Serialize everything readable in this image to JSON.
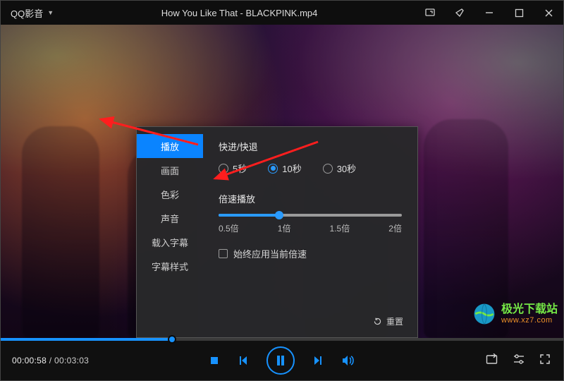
{
  "titlebar": {
    "brand": "QQ影音",
    "title": "How You Like That - BLACKPINK.mp4"
  },
  "settings": {
    "tabs": [
      "播放",
      "画面",
      "色彩",
      "声音",
      "载入字幕",
      "字幕样式"
    ],
    "active_tab": "播放",
    "seek_section_title": "快进/快退",
    "seek_options": [
      "5秒",
      "10秒",
      "30秒"
    ],
    "seek_selected": "10秒",
    "speed_section_title": "倍速播放",
    "speed_labels": [
      "0.5倍",
      "1倍",
      "1.5倍",
      "2倍"
    ],
    "speed_value_fraction": 0.333,
    "always_apply_label": "始终应用当前倍速",
    "always_apply_checked": false,
    "reset_label": "重置"
  },
  "controls": {
    "time_current": "00:00:58",
    "time_total": "00:03:03",
    "progress_fraction": 0.305
  },
  "watermark": {
    "line1": "极光下载站",
    "line2": "www.xz7.com"
  }
}
